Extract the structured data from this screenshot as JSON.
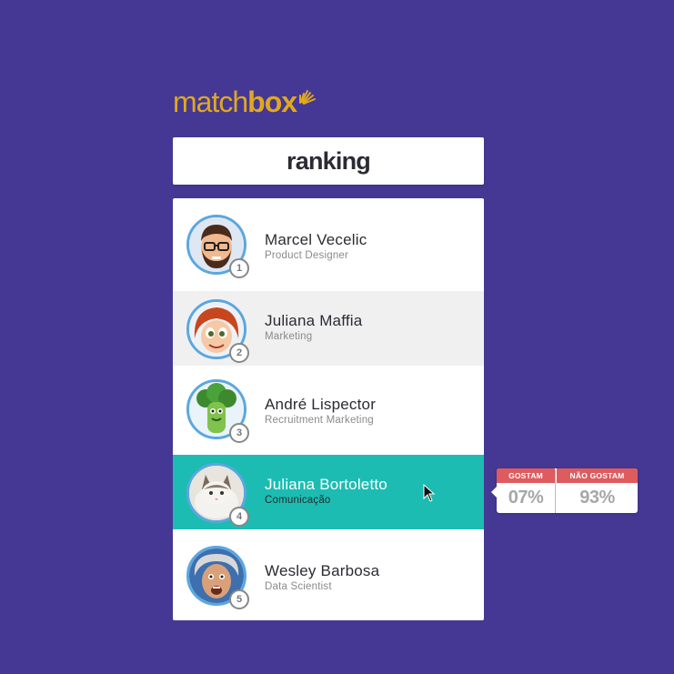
{
  "brand": {
    "logo_thin": "match",
    "logo_bold": "box",
    "color": "#e0a81f"
  },
  "page_title": "ranking",
  "colors": {
    "background": "#453895",
    "active_row": "#1dbcb2",
    "alt_row": "#f1f0f1",
    "avatar_ring": "#5aa7e0",
    "tooltip_header": "#de5b5e"
  },
  "ranking": [
    {
      "rank": "1",
      "name": "Marcel Vecelic",
      "role": "Product Designer",
      "avatar": "bearded-man-avatar"
    },
    {
      "rank": "2",
      "name": "Juliana Maffia",
      "role": "Marketing",
      "avatar": "cartoon-girl-avatar"
    },
    {
      "rank": "3",
      "name": "André Lispector",
      "role": "Recruitment Marketing",
      "avatar": "broccoli-avatar"
    },
    {
      "rank": "4",
      "name": "Juliana Bortoletto",
      "role": "Comunicação",
      "avatar": "cat-avatar"
    },
    {
      "rank": "5",
      "name": "Wesley Barbosa",
      "role": "Data Scientist",
      "avatar": "old-man-avatar"
    }
  ],
  "tooltip": {
    "like_label": "GOSTAM",
    "like_value": "07%",
    "dislike_label": "NÃO GOSTAM",
    "dislike_value": "93%"
  }
}
